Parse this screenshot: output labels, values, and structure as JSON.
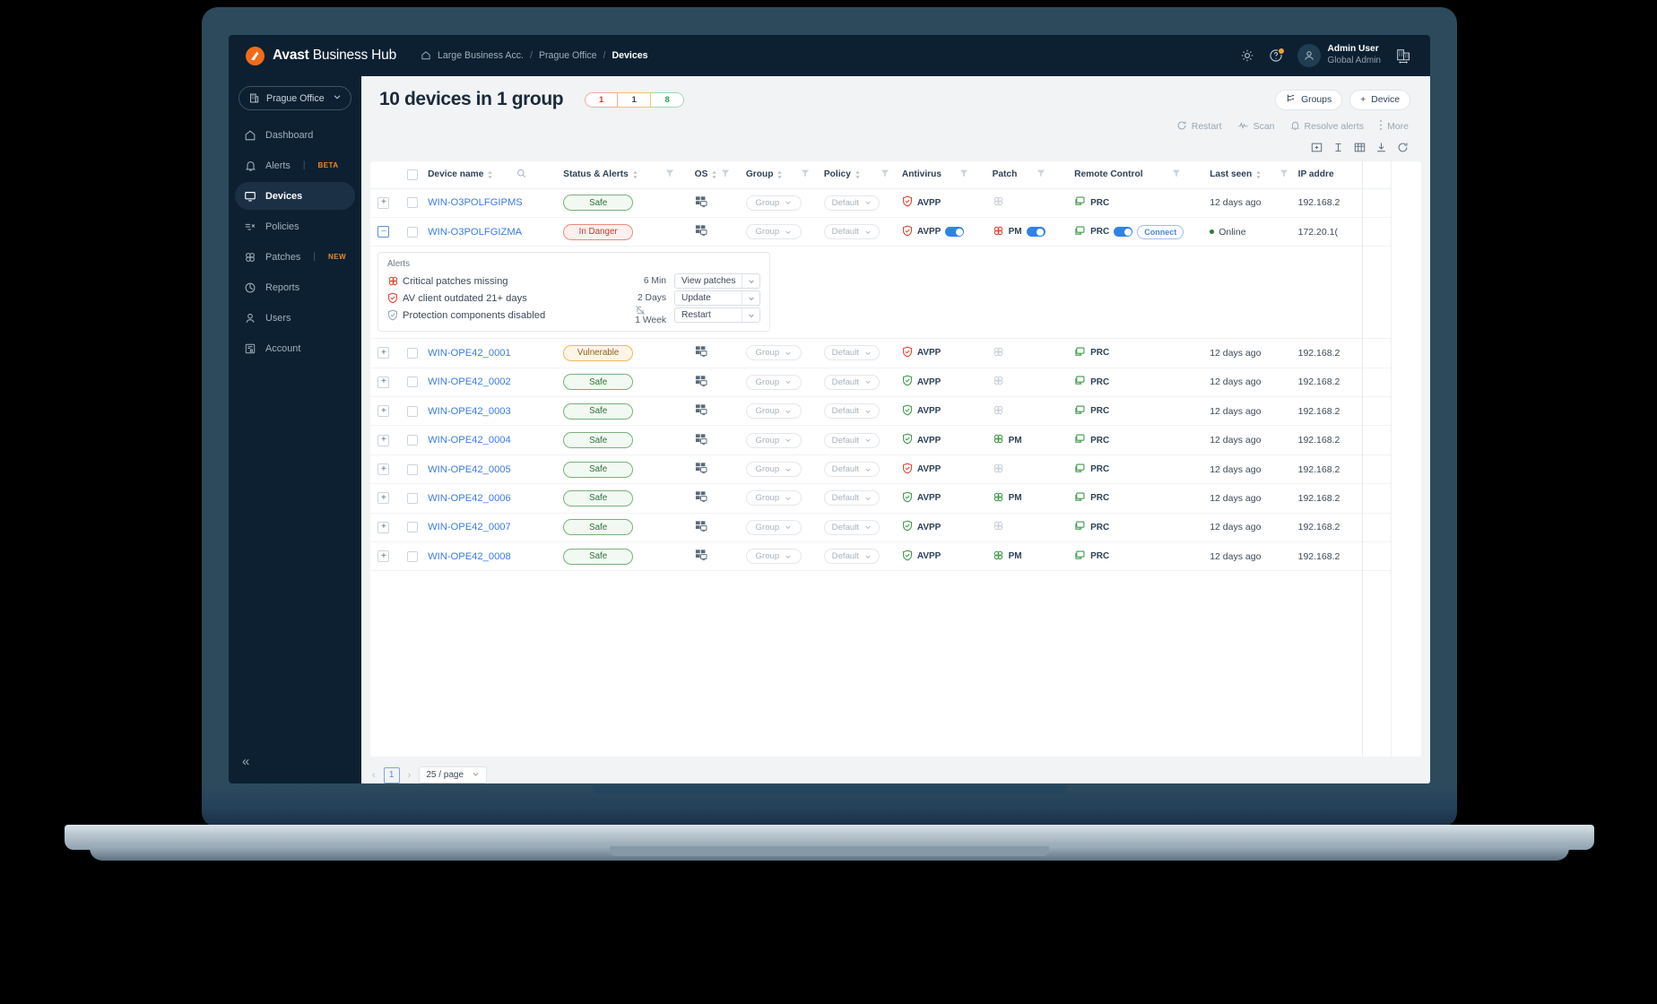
{
  "brand": {
    "bold": "Avast",
    "light": " Business Hub"
  },
  "breadcrumb": {
    "items": [
      "Large Business Acc.",
      "Prague Office",
      "Devices"
    ],
    "separator": "/"
  },
  "topbar": {
    "settings_icon": "gear-icon",
    "help_icon": "help-icon",
    "user_name": "Admin User",
    "user_role": "Global Admin",
    "company_switch_icon": "company-switch-icon"
  },
  "sidebar": {
    "org": "Prague Office",
    "items": [
      {
        "label": "Dashboard",
        "icon": "home-icon",
        "tag": "",
        "active": false
      },
      {
        "label": "Alerts",
        "icon": "bell-icon",
        "tag": "BETA",
        "active": false
      },
      {
        "label": "Devices",
        "icon": "monitor-icon",
        "tag": "",
        "active": true
      },
      {
        "label": "Policies",
        "icon": "policies-icon",
        "tag": "",
        "active": false
      },
      {
        "label": "Patches",
        "icon": "patch-icon",
        "tag": "NEW",
        "active": false
      },
      {
        "label": "Reports",
        "icon": "reports-icon",
        "tag": "",
        "active": false
      },
      {
        "label": "Users",
        "icon": "user-icon",
        "tag": "",
        "active": false
      },
      {
        "label": "Account",
        "icon": "account-icon",
        "tag": "",
        "active": false
      }
    ],
    "collapse_label": "«"
  },
  "main": {
    "title": "10 devices in 1 group",
    "status_counts": {
      "danger": "1",
      "vulnerable": "1",
      "safe": "8"
    },
    "groups_button": "Groups",
    "device_button": "Device",
    "device_button_prefix": "+",
    "actions": [
      {
        "label": "Restart",
        "icon": "restart-icon"
      },
      {
        "label": "Scan",
        "icon": "scan-icon"
      },
      {
        "label": "Resolve alerts",
        "icon": "bell-icon"
      },
      {
        "label": "More",
        "icon": "more-icon"
      }
    ],
    "view_icons": [
      "expand-rows-icon",
      "row-height-icon",
      "grid-icon",
      "export-icon",
      "refresh-icon"
    ]
  },
  "table": {
    "columns": [
      {
        "label": "Device name",
        "sortable": true,
        "search": true
      },
      {
        "label": "Status & Alerts",
        "sortable": true,
        "filter": true
      },
      {
        "label": "OS",
        "sortable": true,
        "filter": true
      },
      {
        "label": "Group",
        "sortable": true,
        "filter": true
      },
      {
        "label": "Policy",
        "sortable": true,
        "filter": true
      },
      {
        "label": "Antivirus",
        "sortable": false,
        "filter": true
      },
      {
        "label": "Patch",
        "sortable": false,
        "filter": true
      },
      {
        "label": "Remote Control",
        "sortable": false,
        "filter": true
      },
      {
        "label": "Last seen",
        "sortable": true,
        "filter": true
      },
      {
        "label": "IP addre",
        "sortable": false,
        "filter": false
      }
    ],
    "group_value": "Group",
    "policy_value": "Default",
    "rows": [
      {
        "name": "WIN-O3POLFGIPMS",
        "status": "Safe",
        "status_kind": "safe",
        "av": "AVPP",
        "av_state": "danger",
        "patch": "",
        "patch_state": "off",
        "rc": "PRC",
        "last_seen": "12 days ago",
        "ip": "192.168.2",
        "expanded": false
      },
      {
        "name": "WIN-O3POLFGIZMA",
        "status": "In Danger",
        "status_kind": "danger",
        "av": "AVPP",
        "av_state": "danger",
        "patch": "PM",
        "patch_state": "danger",
        "rc": "PRC",
        "last_seen": "Online",
        "ip": "172.20.1(",
        "expanded": true,
        "toggles": true,
        "connect": "Connect",
        "online": true
      },
      {
        "name": "WIN-OPE42_0001",
        "status": "Vulnerable",
        "status_kind": "vuln",
        "av": "AVPP",
        "av_state": "danger",
        "patch": "",
        "patch_state": "off",
        "rc": "PRC",
        "last_seen": "12 days ago",
        "ip": "192.168.2",
        "expanded": false
      },
      {
        "name": "WIN-OPE42_0002",
        "status": "Safe",
        "status_kind": "safe",
        "av": "AVPP",
        "av_state": "ok",
        "patch": "",
        "patch_state": "off",
        "rc": "PRC",
        "last_seen": "12 days ago",
        "ip": "192.168.2",
        "expanded": false
      },
      {
        "name": "WIN-OPE42_0003",
        "status": "Safe",
        "status_kind": "safe",
        "av": "AVPP",
        "av_state": "ok",
        "patch": "",
        "patch_state": "off",
        "rc": "PRC",
        "last_seen": "12 days ago",
        "ip": "192.168.2",
        "expanded": false
      },
      {
        "name": "WIN-OPE42_0004",
        "status": "Safe",
        "status_kind": "safe",
        "av": "AVPP",
        "av_state": "ok",
        "patch": "PM",
        "patch_state": "ok",
        "rc": "PRC",
        "last_seen": "12 days ago",
        "ip": "192.168.2",
        "expanded": false
      },
      {
        "name": "WIN-OPE42_0005",
        "status": "Safe",
        "status_kind": "safe",
        "av": "AVPP",
        "av_state": "danger",
        "patch": "",
        "patch_state": "off",
        "rc": "PRC",
        "last_seen": "12 days ago",
        "ip": "192.168.2",
        "expanded": false
      },
      {
        "name": "WIN-OPE42_0006",
        "status": "Safe",
        "status_kind": "safe",
        "av": "AVPP",
        "av_state": "ok",
        "patch": "PM",
        "patch_state": "ok",
        "rc": "PRC",
        "last_seen": "12 days ago",
        "ip": "192.168.2",
        "expanded": false
      },
      {
        "name": "WIN-OPE42_0007",
        "status": "Safe",
        "status_kind": "safe",
        "av": "AVPP",
        "av_state": "ok",
        "patch": "",
        "patch_state": "off",
        "rc": "PRC",
        "last_seen": "12 days ago",
        "ip": "192.168.2",
        "expanded": false
      },
      {
        "name": "WIN-OPE42_0008",
        "status": "Safe",
        "status_kind": "safe",
        "av": "AVPP",
        "av_state": "ok",
        "patch": "PM",
        "patch_state": "ok",
        "rc": "PRC",
        "last_seen": "12 days ago",
        "ip": "192.168.2",
        "expanded": false
      }
    ]
  },
  "alerts_panel": {
    "title": "Alerts",
    "items": [
      {
        "text": "Critical patches missing",
        "icon": "patch-icon",
        "icon_color": "danger",
        "time": "6 Min",
        "action": "View patches",
        "muted": false
      },
      {
        "text": "AV client outdated 21+ days",
        "icon": "shield-icon",
        "icon_color": "danger",
        "time": "2 Days",
        "action": "Update",
        "muted": false
      },
      {
        "text": "Protection components disabled",
        "icon": "shield-icon",
        "icon_color": "grey",
        "time": "1 Week",
        "action": "Restart",
        "muted": true
      }
    ]
  },
  "pagination": {
    "prev": "‹",
    "page": "1",
    "next": "›",
    "page_size": "25 / page"
  },
  "colors": {
    "navy": "#0c2031",
    "accent_orange": "#f06c1a",
    "link_blue": "#3b7de0",
    "toggle_blue": "#2f82e8",
    "safe_green": "#2f6f3c",
    "danger_red": "#c23b28",
    "warn_yellow": "#8a6418"
  }
}
